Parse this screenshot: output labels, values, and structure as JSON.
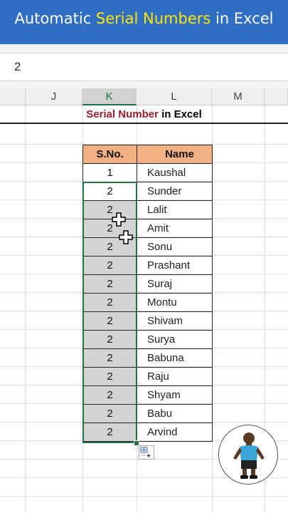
{
  "banner": {
    "part1": "Automatic ",
    "part2": "Serial Numbers",
    "part3": " in Excel"
  },
  "formula_bar": {
    "value": "2"
  },
  "column_headers": [
    "J",
    "K",
    "L",
    "M"
  ],
  "sheet_title": {
    "red": "Serial Number",
    "rest": " in Excel"
  },
  "table": {
    "headers": [
      "S.No.",
      "Name"
    ],
    "rows": [
      {
        "sno": "1",
        "name": "Kaushal"
      },
      {
        "sno": "2",
        "name": "Sunder"
      },
      {
        "sno": "2",
        "name": "Lalit"
      },
      {
        "sno": "2",
        "name": "Amit"
      },
      {
        "sno": "2",
        "name": "Sonu"
      },
      {
        "sno": "2",
        "name": "Prashant"
      },
      {
        "sno": "2",
        "name": "Suraj"
      },
      {
        "sno": "2",
        "name": "Montu"
      },
      {
        "sno": "2",
        "name": "Shivam"
      },
      {
        "sno": "2",
        "name": "Surya"
      },
      {
        "sno": "2",
        "name": "Babuna"
      },
      {
        "sno": "2",
        "name": "Raju"
      },
      {
        "sno": "2",
        "name": "Shyam"
      },
      {
        "sno": "2",
        "name": "Babu"
      },
      {
        "sno": "2",
        "name": "Arvind"
      }
    ]
  },
  "icons": {
    "cursor": "fill-cross-cursor-icon",
    "autofill": "auto-fill-options-icon",
    "avatar": "presenter-avatar-icon"
  },
  "colors": {
    "banner": "#2f6ec4",
    "banner_highlight": "#ffe500",
    "header_fill": "#f3b183",
    "selection": "#217346",
    "title_red": "#9b1d2a"
  }
}
